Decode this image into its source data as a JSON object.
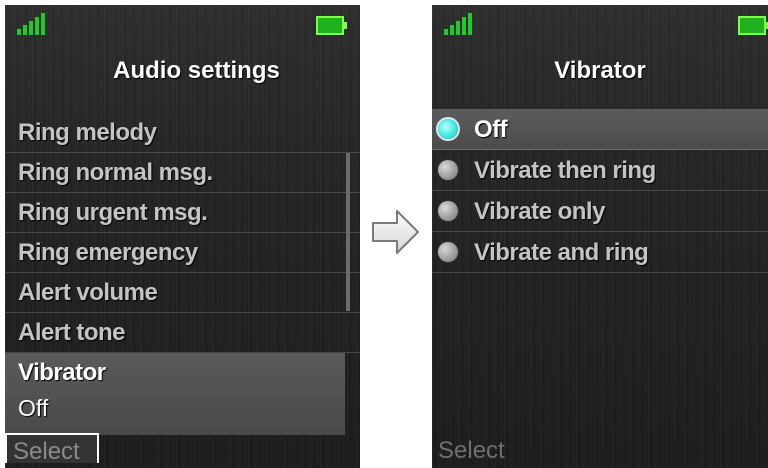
{
  "left_screen": {
    "title": "Audio settings",
    "menu_items": [
      {
        "label": "Ring melody"
      },
      {
        "label": "Ring normal msg."
      },
      {
        "label": "Ring urgent msg."
      },
      {
        "label": "Ring emergency"
      },
      {
        "label": "Alert volume"
      },
      {
        "label": "Alert tone"
      },
      {
        "label": "Vibrator",
        "value": "Off",
        "selected": true
      }
    ],
    "softkey_left": "Select"
  },
  "right_screen": {
    "title": "Vibrator",
    "options": [
      {
        "label": "Off",
        "checked": true
      },
      {
        "label": "Vibrate then ring",
        "checked": false
      },
      {
        "label": "Vibrate only",
        "checked": false
      },
      {
        "label": "Vibrate and ring",
        "checked": false
      }
    ],
    "softkey_left": "Select"
  },
  "icons": {
    "signal": "signal-strength-icon",
    "battery": "battery-full-icon",
    "arrow": "right-arrow-icon",
    "radio_checked": "radio-checked-icon",
    "radio_unchecked": "radio-unchecked-icon"
  },
  "colors": {
    "signal": "#22c92d",
    "battery": "#1fb21e",
    "radio_checked": "#3ee8e2"
  }
}
